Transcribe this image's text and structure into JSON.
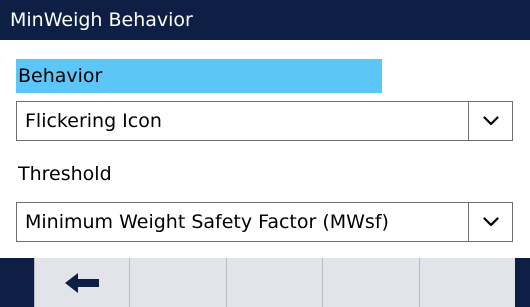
{
  "window": {
    "title": "MinWeigh Behavior"
  },
  "fields": {
    "behavior": {
      "label": "Behavior",
      "value": "Flickering Icon"
    },
    "threshold": {
      "label": "Threshold",
      "value": "Minimum Weight Safety Factor (MWsf)"
    }
  },
  "softkeys": [
    {
      "icon": "back-arrow-icon"
    },
    {
      "icon": ""
    },
    {
      "icon": ""
    },
    {
      "icon": ""
    },
    {
      "icon": ""
    }
  ],
  "colors": {
    "title_bar": "#0d1f45",
    "selection_highlight": "#5cc6f8",
    "softkey_bg": "#e3e4ea"
  }
}
